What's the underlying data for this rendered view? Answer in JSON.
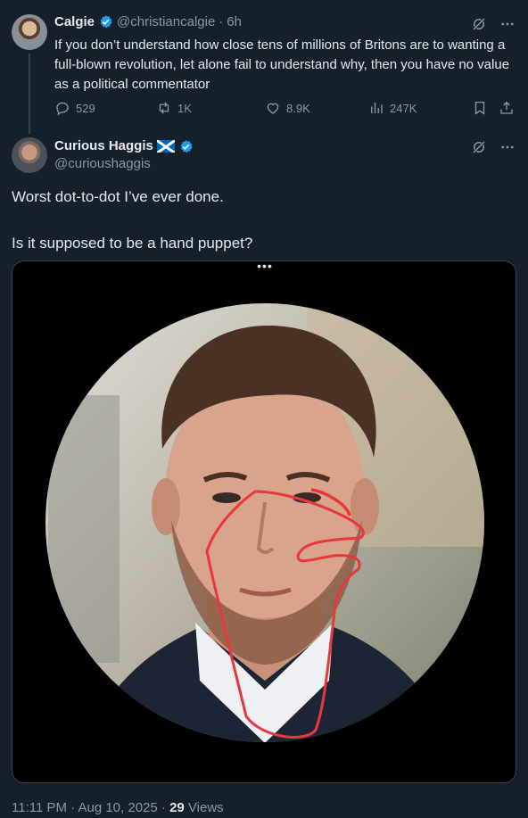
{
  "parent_tweet": {
    "author_name": "Calgie",
    "handle": "@christiancalgie",
    "separator": "·",
    "time": "6h",
    "text": "If you don’t understand how close tens of millions of Britons are to wanting a full-blown revolution, let alone fail to understand why, then you have no value as a political commentator",
    "stats": {
      "replies": "529",
      "reposts": "1K",
      "likes": "8.9K",
      "views": "247K"
    }
  },
  "reply_tweet": {
    "author_name": "Curious Haggis",
    "handle": "@curioushaggis",
    "text_line1": "Worst dot-to-dot I’ve ever done.",
    "text_line2": "Is it supposed to be a hand puppet?",
    "media_menu": "•••",
    "footer_time": "11:11 PM · Aug 10, 2025 · ",
    "footer_views_count": "29",
    "footer_views_label": " Views"
  },
  "colors": {
    "background": "#15202b",
    "verified": "#1d9bf0",
    "text": "#e7e9ea",
    "muted": "#8b98a5",
    "annotation": "#e8373d"
  },
  "icons": [
    "verified-badge-icon",
    "grok-icon",
    "more-icon",
    "reply-icon",
    "repost-icon",
    "like-icon",
    "views-icon",
    "bookmark-icon",
    "share-icon",
    "scotland-flag-icon"
  ]
}
